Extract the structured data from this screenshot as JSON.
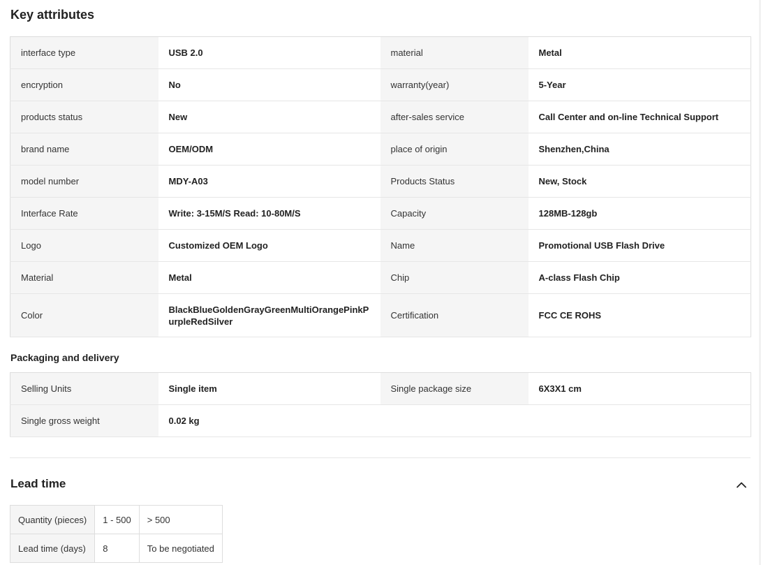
{
  "key_attributes": {
    "title": "Key attributes",
    "rows": [
      {
        "k1": "interface type",
        "v1": "USB 2.0",
        "k2": "material",
        "v2": "Metal"
      },
      {
        "k1": "encryption",
        "v1": "No",
        "k2": "warranty(year)",
        "v2": "5-Year"
      },
      {
        "k1": "products status",
        "v1": "New",
        "k2": "after-sales service",
        "v2": "Call Center and on-line Technical Support"
      },
      {
        "k1": "brand name",
        "v1": "OEM/ODM",
        "k2": "place of origin",
        "v2": "Shenzhen,China"
      },
      {
        "k1": "model number",
        "v1": "MDY-A03",
        "k2": "Products Status",
        "v2": "New, Stock"
      },
      {
        "k1": "Interface Rate",
        "v1": "Write: 3-15M/S Read: 10-80M/S",
        "k2": "Capacity",
        "v2": "128MB-128gb"
      },
      {
        "k1": "Logo",
        "v1": "Customized OEM Logo",
        "k2": "Name",
        "v2": "Promotional USB Flash Drive"
      },
      {
        "k1": "Material",
        "v1": "Metal",
        "k2": "Chip",
        "v2": "A-class Flash Chip"
      },
      {
        "k1": "Color",
        "v1": "BlackBlueGoldenGrayGreenMultiOrangePinkPurpleRedSilver",
        "k2": "Certification",
        "v2": "FCC CE ROHS"
      }
    ]
  },
  "packaging": {
    "title": "Packaging and delivery",
    "rows": [
      {
        "k1": "Selling Units",
        "v1": "Single item",
        "k2": "Single package size",
        "v2": "6X3X1 cm"
      },
      {
        "k1": "Single gross weight",
        "v1": "0.02 kg"
      }
    ]
  },
  "lead_time": {
    "title": "Lead time",
    "collapse_icon": "chevron-up-icon",
    "quantity_label": "Quantity (pieces)",
    "quantity_ranges": [
      "1 - 500",
      "> 500"
    ],
    "days_label": "Lead time (days)",
    "days_values": [
      "8",
      "To be negotiated"
    ]
  }
}
